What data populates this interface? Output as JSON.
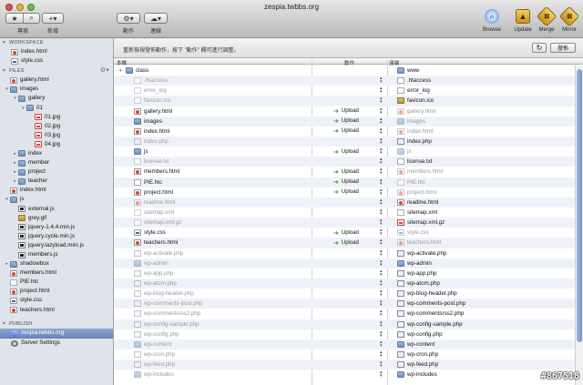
{
  "window": {
    "title": "zespia.twbbs.org"
  },
  "toolbar": {
    "view_label": "專案",
    "add_label": "新增",
    "action_label": "動作",
    "upload_label": "連線",
    "browse_label": "Browse",
    "update_label": "Update",
    "merge_label": "Merge",
    "mirror_label": "Mirror"
  },
  "sidebar": {
    "workspace_header": "WORKSPACE",
    "workspace_items": [
      {
        "label": "index.html",
        "type": "html"
      },
      {
        "label": "style.css",
        "type": "css"
      }
    ],
    "files_header": "FILES",
    "file_items": [
      {
        "label": "gallery.html",
        "type": "html",
        "level": 0,
        "expand": ""
      },
      {
        "label": "images",
        "type": "folder",
        "level": 0,
        "expand": "▾"
      },
      {
        "label": "gallery",
        "type": "folder",
        "level": 1,
        "expand": "▾"
      },
      {
        "label": "01",
        "type": "folder",
        "level": 2,
        "expand": "▾"
      },
      {
        "label": "01.jpg",
        "type": "img",
        "level": 3,
        "expand": ""
      },
      {
        "label": "02.jpg",
        "type": "img",
        "level": 3,
        "expand": ""
      },
      {
        "label": "03.jpg",
        "type": "img",
        "level": 3,
        "expand": ""
      },
      {
        "label": "04.jpg",
        "type": "img",
        "level": 3,
        "expand": ""
      },
      {
        "label": "index",
        "type": "folder",
        "level": 1,
        "expand": "▸"
      },
      {
        "label": "member",
        "type": "folder",
        "level": 1,
        "expand": "▸"
      },
      {
        "label": "project",
        "type": "folder",
        "level": 1,
        "expand": "▸"
      },
      {
        "label": "teacher",
        "type": "folder",
        "level": 1,
        "expand": "▸"
      },
      {
        "label": "index.html",
        "type": "html",
        "level": 0,
        "expand": ""
      },
      {
        "label": "js",
        "type": "folder",
        "level": 0,
        "expand": "▾"
      },
      {
        "label": "external.js",
        "type": "js",
        "level": 1,
        "expand": ""
      },
      {
        "label": "grey.gif",
        "type": "gif",
        "level": 1,
        "expand": ""
      },
      {
        "label": "jquery-1.4.4.min.js",
        "type": "js",
        "level": 1,
        "expand": ""
      },
      {
        "label": "jquery.cycle.min.js",
        "type": "js",
        "level": 1,
        "expand": ""
      },
      {
        "label": "jquery.lazyload.mini.js",
        "type": "js",
        "level": 1,
        "expand": ""
      },
      {
        "label": "members.js",
        "type": "js",
        "level": 1,
        "expand": ""
      },
      {
        "label": "shadowbox",
        "type": "folder",
        "level": 0,
        "expand": "▸"
      },
      {
        "label": "members.html",
        "type": "html",
        "level": 0,
        "expand": ""
      },
      {
        "label": "PIE.htc",
        "type": "gen",
        "level": 0,
        "expand": ""
      },
      {
        "label": "project.html",
        "type": "html",
        "level": 0,
        "expand": ""
      },
      {
        "label": "style.css",
        "type": "css",
        "level": 0,
        "expand": ""
      },
      {
        "label": "teachers.html",
        "type": "html",
        "level": 0,
        "expand": ""
      }
    ],
    "publish_header": "PUBLISH",
    "publish_items": [
      {
        "label": "zespia.twbbs.org",
        "type": "site",
        "selected": true
      },
      {
        "label": "Server Settings",
        "type": "gear",
        "selected": false
      }
    ]
  },
  "main": {
    "instruction": "重新檢視發佈動作，按下 \"動作\" 欄可進行調整。",
    "refresh_icon": "refresh-icon",
    "publish_button": "發佈",
    "columns": {
      "local": "本機",
      "action": "動作",
      "remote": "遠端"
    },
    "rows": [
      {
        "local": "class",
        "ltype": "folder",
        "ldim": false,
        "lexp": "▾",
        "action": "",
        "remote": "www",
        "rtype": "folder",
        "rdim": false,
        "stepper": false
      },
      {
        "local": ".htaccess",
        "ltype": "gen",
        "ldim": true,
        "lexp": "",
        "action": "",
        "remote": ".htaccess",
        "rtype": "gen",
        "rdim": false,
        "stepper": true
      },
      {
        "local": "error_log",
        "ltype": "gen",
        "ldim": true,
        "lexp": "",
        "action": "",
        "remote": "error_log",
        "rtype": "gen",
        "rdim": false,
        "stepper": true
      },
      {
        "local": "favicon.ico",
        "ltype": "gen",
        "ldim": true,
        "lexp": "",
        "action": "",
        "remote": "favicon.ico",
        "rtype": "gif",
        "rdim": false,
        "stepper": true
      },
      {
        "local": "gallery.html",
        "ltype": "html",
        "ldim": false,
        "lexp": "",
        "action": "Upload",
        "remote": "gallery.html",
        "rtype": "html",
        "rdim": true,
        "stepper": true
      },
      {
        "local": "images",
        "ltype": "folder",
        "ldim": false,
        "lexp": "",
        "action": "Upload",
        "remote": "images",
        "rtype": "folder",
        "rdim": true,
        "stepper": true
      },
      {
        "local": "index.html",
        "ltype": "html",
        "ldim": false,
        "lexp": "",
        "action": "Upload",
        "remote": "index.html",
        "rtype": "html",
        "rdim": true,
        "stepper": true
      },
      {
        "local": "index.php",
        "ltype": "php",
        "ldim": true,
        "lexp": "",
        "action": "",
        "remote": "index.php",
        "rtype": "php",
        "rdim": false,
        "stepper": true
      },
      {
        "local": "js",
        "ltype": "folder",
        "ldim": false,
        "lexp": "",
        "action": "Upload",
        "remote": "js",
        "rtype": "folder",
        "rdim": true,
        "stepper": true
      },
      {
        "local": "license.txt",
        "ltype": "gen",
        "ldim": true,
        "lexp": "",
        "action": "",
        "remote": "license.txt",
        "rtype": "gen",
        "rdim": false,
        "stepper": true
      },
      {
        "local": "members.html",
        "ltype": "html",
        "ldim": false,
        "lexp": "",
        "action": "Upload",
        "remote": "members.html",
        "rtype": "html",
        "rdim": true,
        "stepper": true
      },
      {
        "local": "PIE.htc",
        "ltype": "gen",
        "ldim": false,
        "lexp": "",
        "action": "Upload",
        "remote": "PIE.htc",
        "rtype": "gen",
        "rdim": true,
        "stepper": true
      },
      {
        "local": "project.html",
        "ltype": "html",
        "ldim": false,
        "lexp": "",
        "action": "Upload",
        "remote": "project.html",
        "rtype": "html",
        "rdim": true,
        "stepper": true
      },
      {
        "local": "readme.html",
        "ltype": "html",
        "ldim": true,
        "lexp": "",
        "action": "",
        "remote": "readme.html",
        "rtype": "html",
        "rdim": false,
        "stepper": true
      },
      {
        "local": "sitemap.xml",
        "ltype": "gen",
        "ldim": true,
        "lexp": "",
        "action": "",
        "remote": "sitemap.xml",
        "rtype": "gen",
        "rdim": false,
        "stepper": true
      },
      {
        "local": "sitemap.xml.gz",
        "ltype": "gen",
        "ldim": true,
        "lexp": "",
        "action": "",
        "remote": "sitemap.xml.gz",
        "rtype": "img",
        "rdim": false,
        "stepper": true
      },
      {
        "local": "style.css",
        "ltype": "css",
        "ldim": false,
        "lexp": "",
        "action": "Upload",
        "remote": "style.css",
        "rtype": "css",
        "rdim": true,
        "stepper": true
      },
      {
        "local": "teachers.html",
        "ltype": "html",
        "ldim": false,
        "lexp": "",
        "action": "Upload",
        "remote": "teachers.html",
        "rtype": "html",
        "rdim": true,
        "stepper": true
      },
      {
        "local": "wp-activate.php",
        "ltype": "php",
        "ldim": true,
        "lexp": "",
        "action": "",
        "remote": "wp-activate.php",
        "rtype": "php",
        "rdim": false,
        "stepper": true
      },
      {
        "local": "wp-admin",
        "ltype": "folder",
        "ldim": true,
        "lexp": "",
        "action": "",
        "remote": "wp-admin",
        "rtype": "folder",
        "rdim": false,
        "stepper": true
      },
      {
        "local": "wp-app.php",
        "ltype": "php",
        "ldim": true,
        "lexp": "",
        "action": "",
        "remote": "wp-app.php",
        "rtype": "php",
        "rdim": false,
        "stepper": true
      },
      {
        "local": "wp-atom.php",
        "ltype": "php",
        "ldim": true,
        "lexp": "",
        "action": "",
        "remote": "wp-atom.php",
        "rtype": "php",
        "rdim": false,
        "stepper": true
      },
      {
        "local": "wp-blog-header.php",
        "ltype": "php",
        "ldim": true,
        "lexp": "",
        "action": "",
        "remote": "wp-blog-header.php",
        "rtype": "php",
        "rdim": false,
        "stepper": true
      },
      {
        "local": "wp-comments-post.php",
        "ltype": "php",
        "ldim": true,
        "lexp": "",
        "action": "",
        "remote": "wp-comments-post.php",
        "rtype": "php",
        "rdim": false,
        "stepper": true
      },
      {
        "local": "wp-commentsrss2.php",
        "ltype": "php",
        "ldim": true,
        "lexp": "",
        "action": "",
        "remote": "wp-commentsrss2.php",
        "rtype": "php",
        "rdim": false,
        "stepper": true
      },
      {
        "local": "wp-config-sample.php",
        "ltype": "php",
        "ldim": true,
        "lexp": "",
        "action": "",
        "remote": "wp-config-sample.php",
        "rtype": "php",
        "rdim": false,
        "stepper": true
      },
      {
        "local": "wp-config.php",
        "ltype": "php",
        "ldim": true,
        "lexp": "",
        "action": "",
        "remote": "wp-config.php",
        "rtype": "php",
        "rdim": false,
        "stepper": true
      },
      {
        "local": "wp-content",
        "ltype": "folder",
        "ldim": true,
        "lexp": "",
        "action": "",
        "remote": "wp-content",
        "rtype": "folder",
        "rdim": false,
        "stepper": true
      },
      {
        "local": "wp-cron.php",
        "ltype": "php",
        "ldim": true,
        "lexp": "",
        "action": "",
        "remote": "wp-cron.php",
        "rtype": "php",
        "rdim": false,
        "stepper": true
      },
      {
        "local": "wp-feed.php",
        "ltype": "php",
        "ldim": true,
        "lexp": "",
        "action": "",
        "remote": "wp-feed.php",
        "rtype": "php",
        "rdim": false,
        "stepper": true
      },
      {
        "local": "wp-includes",
        "ltype": "folder",
        "ldim": true,
        "lexp": "",
        "action": "",
        "remote": "wp-includes",
        "rtype": "folder",
        "rdim": false,
        "stepper": true
      }
    ]
  },
  "watermark": "#867518",
  "colors": {
    "upload_arrow": "#3d9a2d",
    "selection": "#6683b8"
  }
}
